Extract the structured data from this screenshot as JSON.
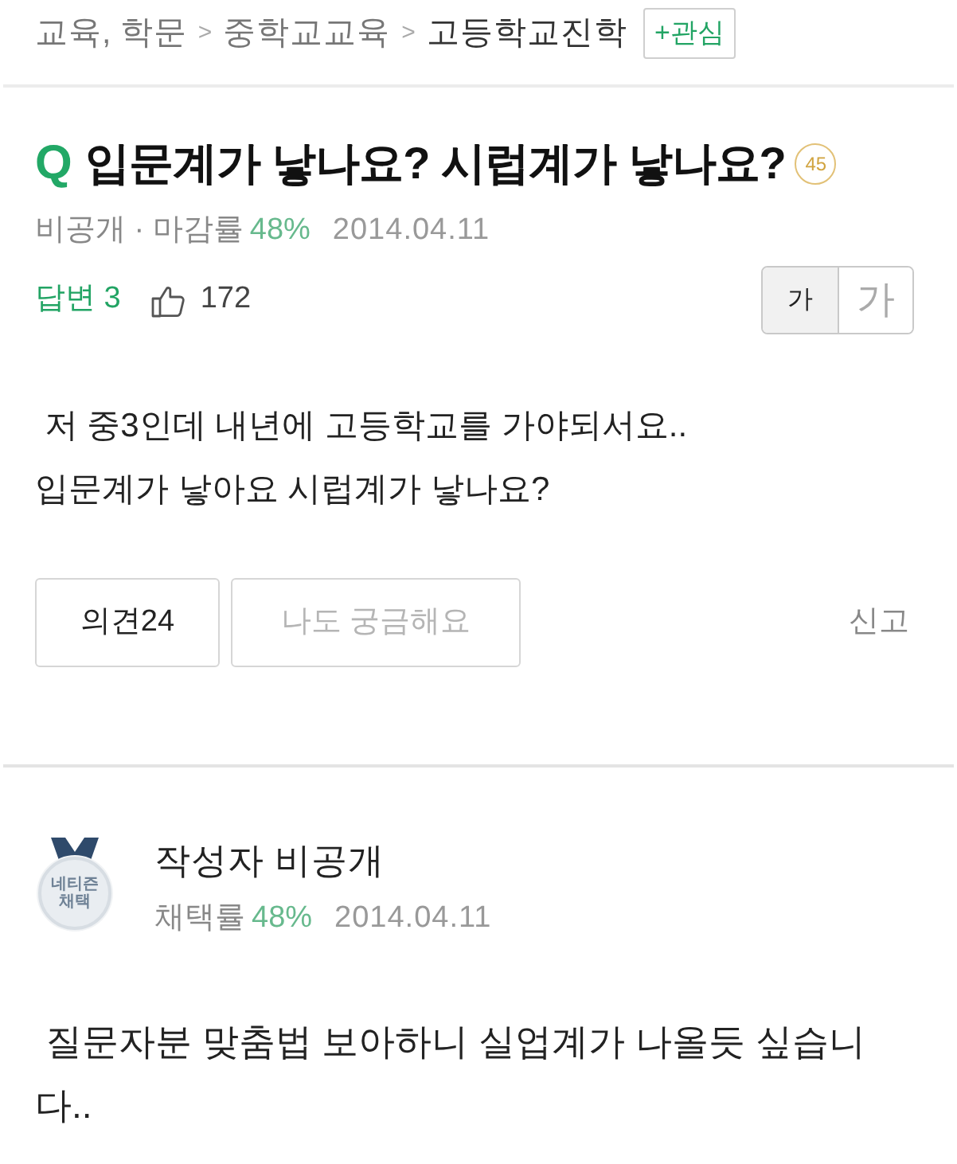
{
  "breadcrumb": {
    "items": [
      {
        "label": "교육, 학문",
        "current": false,
        "separator": ">"
      },
      {
        "label": "중학교교육",
        "current": false,
        "separator": ">"
      },
      {
        "label": "고등학교진학",
        "current": true
      }
    ],
    "follow_button": "+관심"
  },
  "question": {
    "q_mark": "Q",
    "title": "입문계가 낳나요? 시럽계가 낳나요?",
    "points": "45",
    "meta": {
      "author": "비공개 · 마감률",
      "rate": "48%",
      "date": "2014.04.11"
    },
    "answers": "답변 3",
    "likes": "172",
    "font_size_toggle": [
      {
        "label": "가",
        "kind": "small",
        "selected": true
      },
      {
        "label": "가",
        "kind": "large",
        "selected": false
      }
    ],
    "body": " 저 중3인데 내년에 고등학교를 가야되서요..\n입문계가 낳아요 시럽계가 낳나요?",
    "actions": [
      {
        "label": "의견24",
        "kind": "count"
      },
      {
        "label": "나도 궁금해요",
        "kind": "curious"
      }
    ],
    "report": "신고"
  },
  "answer": {
    "medal": {
      "lines": [
        "네티즌",
        "채택"
      ]
    },
    "author": "작성자 비공개",
    "meta": {
      "rate_label": "채택률",
      "rate": "48%",
      "date": "2014.04.11"
    },
    "body": " 질문자분 맞춤법 보아하니 실업계가 나올듯 싶습니다.."
  }
}
